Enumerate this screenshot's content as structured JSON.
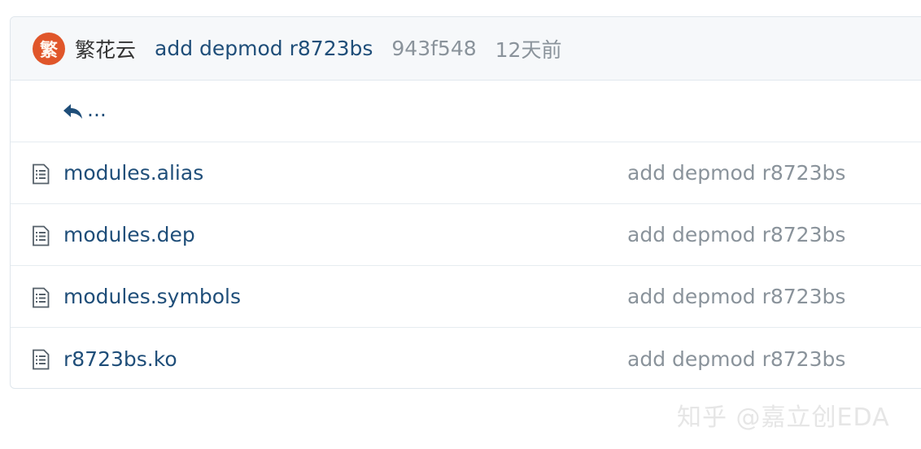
{
  "header": {
    "avatar_text": "繁",
    "author": "繁花云",
    "commit_message": "add depmod r8723bs",
    "commit_sha": "943f548",
    "commit_time": "12天前"
  },
  "parent_dir": {
    "label": "...",
    "icon": "reply-arrow-icon"
  },
  "files": [
    {
      "name": "modules.alias",
      "last_commit": "add depmod r8723bs",
      "icon": "file-text-icon"
    },
    {
      "name": "modules.dep",
      "last_commit": "add depmod r8723bs",
      "icon": "file-text-icon"
    },
    {
      "name": "modules.symbols",
      "last_commit": "add depmod r8723bs",
      "icon": "file-text-icon"
    },
    {
      "name": "r8723bs.ko",
      "last_commit": "add depmod r8723bs",
      "icon": "file-text-icon"
    }
  ],
  "watermark": "知乎 @嘉立创EDA",
  "colors": {
    "link": "#1f4e79",
    "muted": "#8a939b",
    "avatar_bg": "#e0562a",
    "header_bg": "#f6f8fa"
  }
}
